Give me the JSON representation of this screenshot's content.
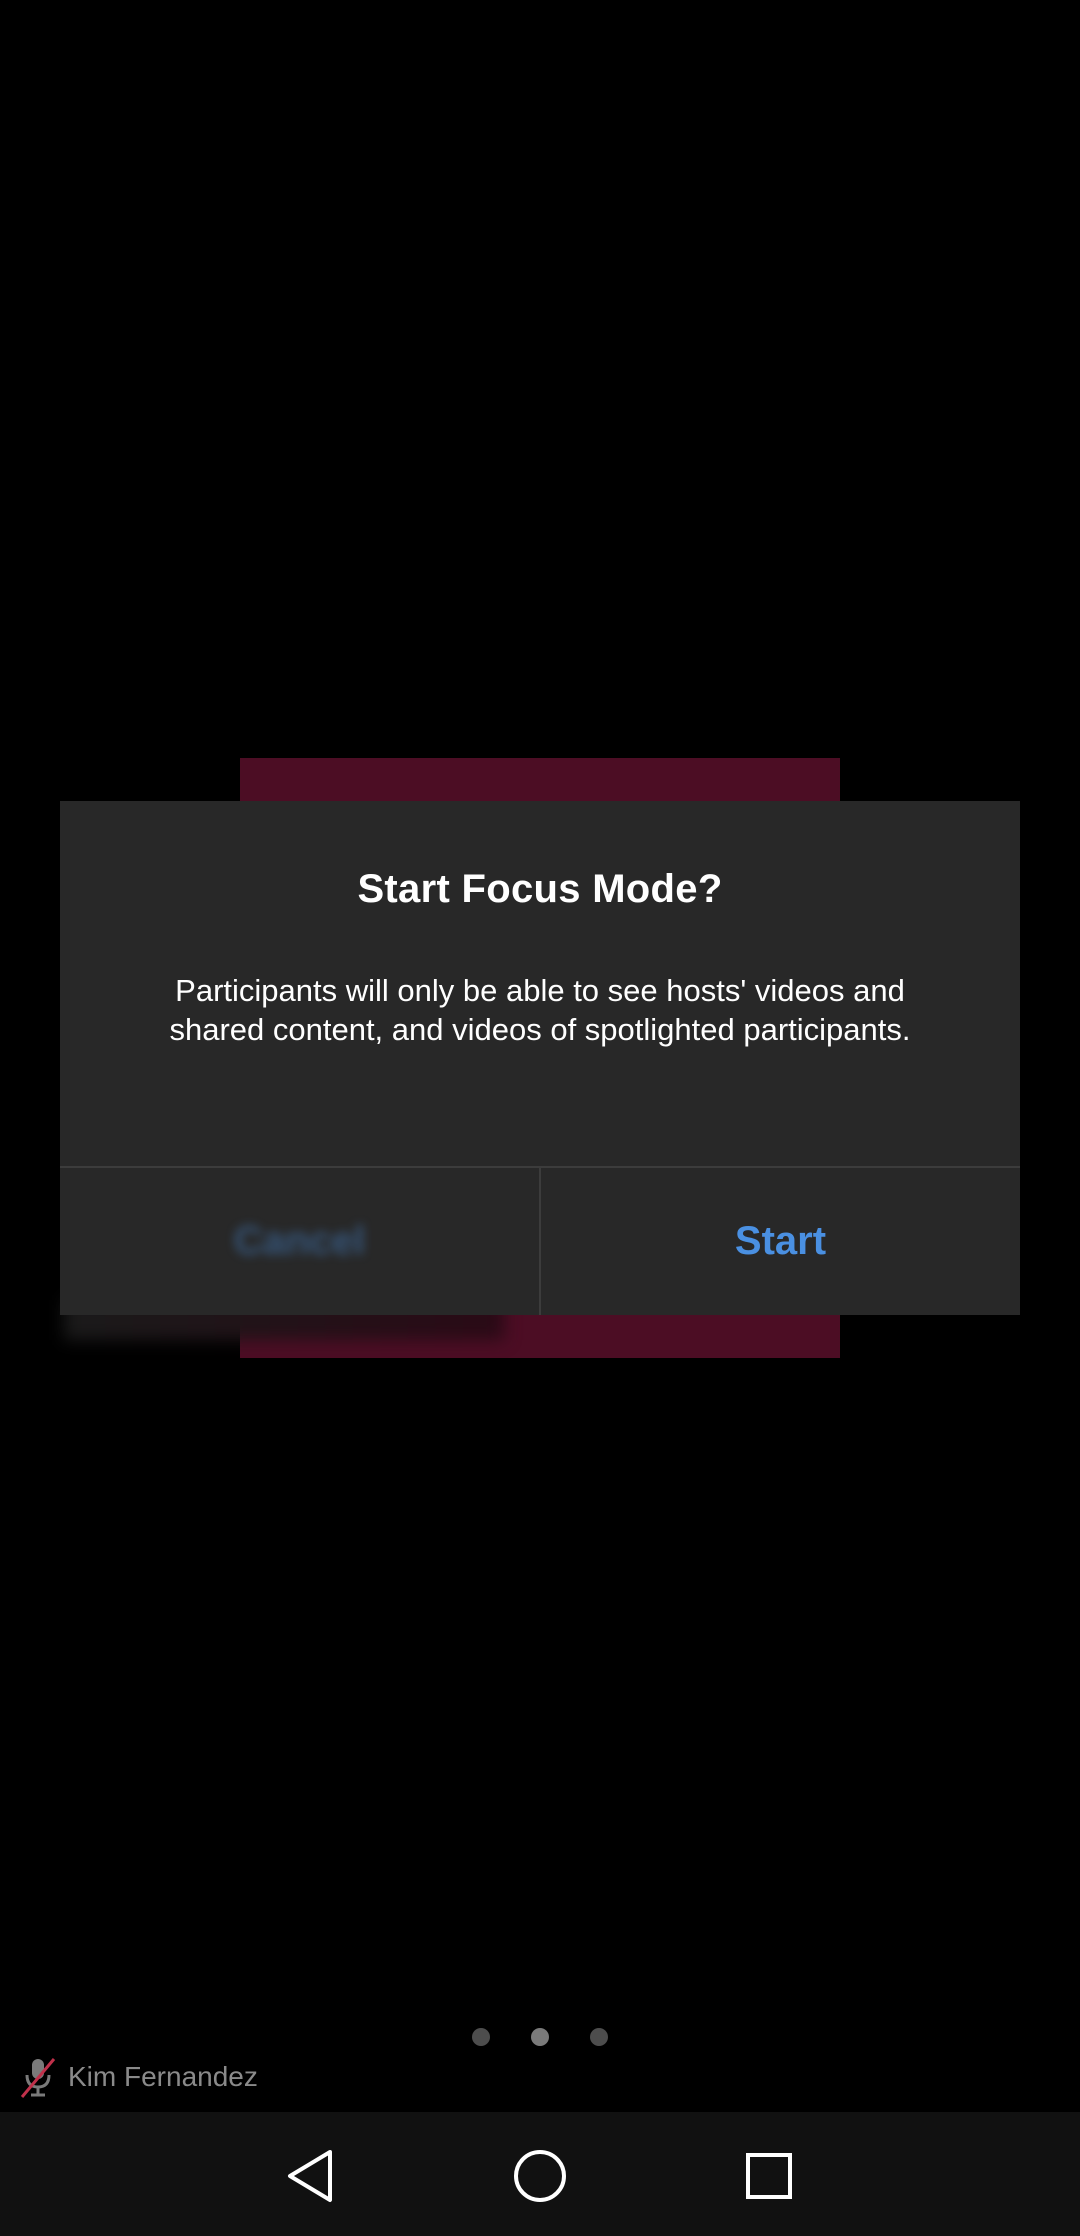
{
  "dialog": {
    "title": "Start Focus Mode?",
    "message": "Participants will only be able to see hosts' videos and shared content, and videos of spotlighted participants.",
    "cancel_label": "Cancel",
    "start_label": "Start"
  },
  "participant": {
    "name": "Kim Fernandez",
    "mic_icon": "mic-muted-icon"
  },
  "page_indicator": {
    "count": 3,
    "active_index": 1
  },
  "colors": {
    "accent": "#4a90e2",
    "tile": "#4c0d24",
    "dialog_bg": "#282828"
  },
  "nav_bar": {
    "back_icon": "back-triangle-icon",
    "home_icon": "home-circle-icon",
    "recents_icon": "recents-square-icon"
  }
}
